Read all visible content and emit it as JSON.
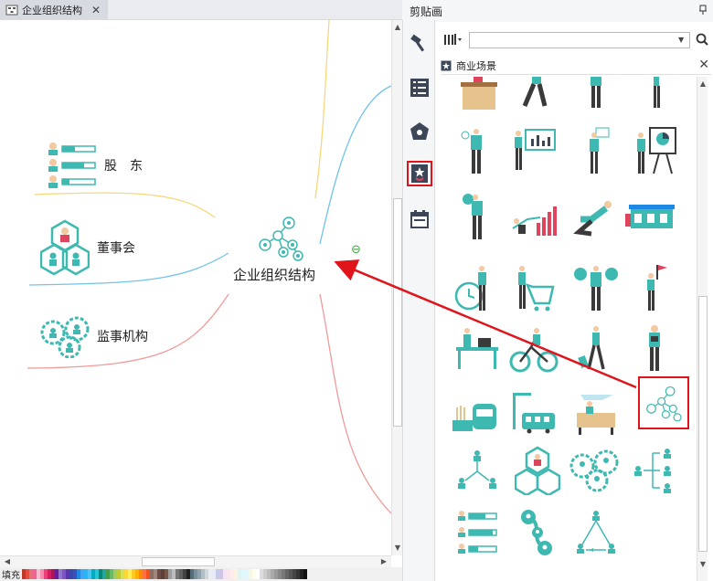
{
  "tab": {
    "label": "企业组织结构",
    "close": "✕"
  },
  "palette": {
    "fill_label": "填充",
    "colors": [
      "#c0392b",
      "#e74c3c",
      "#e57373",
      "#f06292",
      "#f8bbd0",
      "#f48fb1",
      "#ec407a",
      "#d81b60",
      "#ad1457",
      "#6a1b9a",
      "#9575cd",
      "#7e57c2",
      "#5e35b1",
      "#3949ab",
      "#3f51b5",
      "#1e88e5",
      "#42a5f5",
      "#29b6f6",
      "#4fc3f7",
      "#00acc1",
      "#26c6da",
      "#00897b",
      "#26a69a",
      "#43a047",
      "#66bb6a",
      "#9ccc65",
      "#c0ca33",
      "#d4e157",
      "#fdd835",
      "#ffee58",
      "#ffca28",
      "#ffb300",
      "#fb8c00",
      "#ff7043",
      "#f4511e",
      "#8d6e63",
      "#a1887f",
      "#6d4c41",
      "#5d4037",
      "#795548",
      "#9e9e9e",
      "#bdbdbd",
      "#757575",
      "#616161",
      "#424242",
      "#212121",
      "#546e7a",
      "#78909c",
      "#90a4ae",
      "#b0bec5",
      "#cfd8dc",
      "#eceff1",
      "#e8eaf6",
      "#c5cae9",
      "#d1c4e9",
      "#f3e5f5",
      "#fce4ec",
      "#ffebee",
      "#fff3e0",
      "#e0f2f1",
      "#e0f7fa",
      "#e1f5fe",
      "#f1f8e9",
      "#fffde7",
      "#ffffff",
      "#dcdcdc",
      "#cccccc",
      "#bbbbbb",
      "#aaaaaa",
      "#999999",
      "#888888",
      "#777777",
      "#666666",
      "#555555",
      "#444444",
      "#333333",
      "#222222",
      "#111111"
    ]
  },
  "map": {
    "center": "企业组织结构",
    "nodes": [
      {
        "label": "股　东"
      },
      {
        "label": "董事会"
      },
      {
        "label": "监事机构"
      }
    ],
    "collapse_symbol": "⊖"
  },
  "panel": {
    "title": "剪贴画",
    "pin": "📌",
    "search": {
      "value": "",
      "dropdown": "▼"
    },
    "category": {
      "label": "商业场景",
      "close": "✕"
    }
  },
  "colors": {
    "teal": "#3eb9b2",
    "dark": "#3a3a3a",
    "skin": "#f2c9a0",
    "highlight": "#e0141b",
    "wood": "#e6c28c",
    "tool_dark": "#3c4656"
  }
}
